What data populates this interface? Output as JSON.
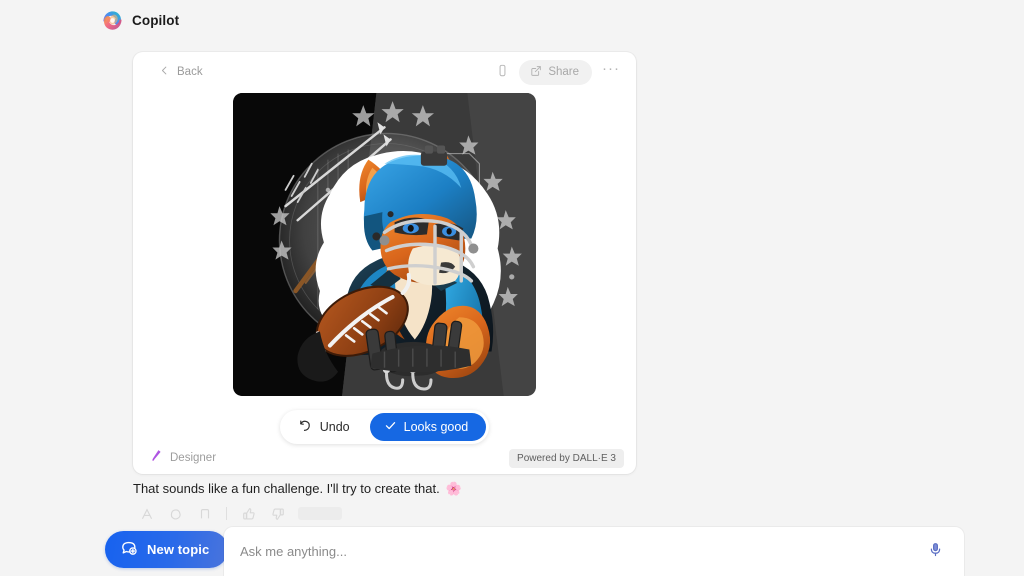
{
  "app": {
    "title": "Copilot",
    "logo_icon": "copilot-logo-icon"
  },
  "card": {
    "toolbar": {
      "back_label": "Back",
      "back_icon": "chevron-left-icon",
      "device_icon": "mobile-device-icon",
      "share_label": "Share",
      "share_icon": "share-icon",
      "more_label": "···",
      "more_icon": "more-horizontal-icon"
    },
    "image": {
      "alt": "Cartoon mascot fox wearing a blue American football helmet and jacket holding a football, with arrows, stars and circuit patterns on a dark background",
      "name": "generated-image"
    },
    "actions": {
      "undo_label": "Undo",
      "undo_icon": "undo-arrow-icon",
      "looks_good_label": "Looks good",
      "looks_good_icon": "checkmark-icon",
      "looks_good_color": "#1668e3"
    },
    "footer": {
      "brand_label": "Designer",
      "brand_icon": "designer-icon",
      "powered_by_label": "Powered by DALL·E 3"
    }
  },
  "message": {
    "text": "That sounds like a fun challenge. I'll try to create that.",
    "emoji": "🌸",
    "toolbar_icons": [
      "read-aloud-icon",
      "copy-icon",
      "bookmark-icon",
      "divider",
      "thumbs-up-icon",
      "thumbs-down-icon",
      "source-badge"
    ]
  },
  "composer": {
    "new_topic_label": "New topic",
    "new_topic_icon": "new-chat-icon",
    "placeholder": "Ask me anything...",
    "input_value": "",
    "mic_icon": "microphone-icon"
  },
  "colors": {
    "background": "#f4f4f4",
    "card_background": "#ffffff",
    "accent_blue": "#1668e3",
    "muted_text": "#9b9b9b"
  }
}
